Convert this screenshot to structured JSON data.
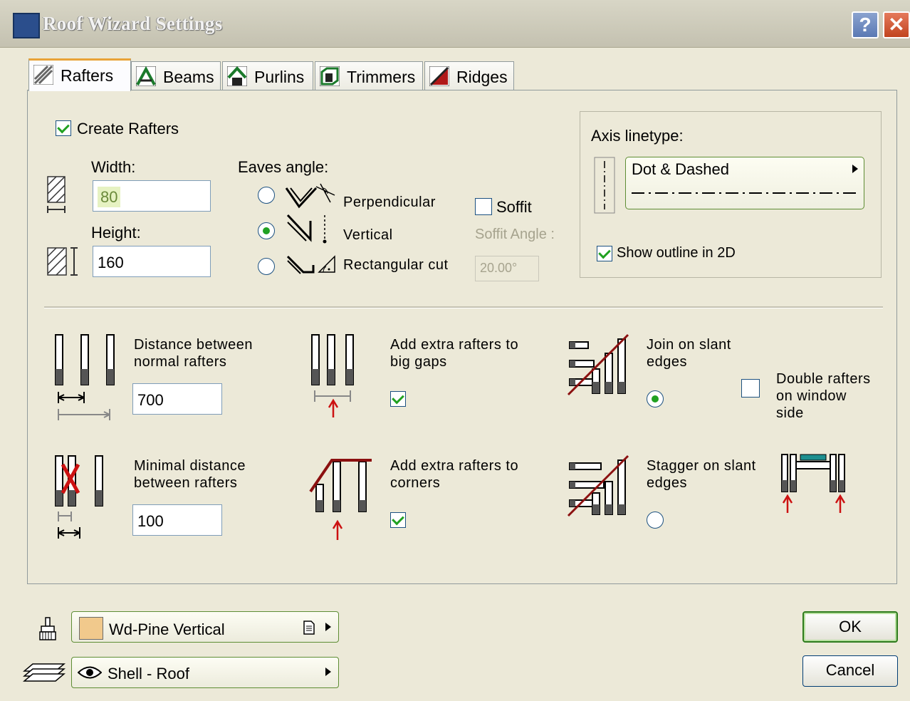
{
  "window": {
    "title": "Roof Wizard Settings",
    "help_label": "?",
    "close_label": "✕"
  },
  "tabs": [
    {
      "label": "Rafters"
    },
    {
      "label": "Beams"
    },
    {
      "label": "Purlins"
    },
    {
      "label": "Trimmers"
    },
    {
      "label": "Ridges"
    }
  ],
  "rafters": {
    "create_label": "Create Rafters",
    "width_label": "Width:",
    "width_value": "80",
    "height_label": "Height:",
    "height_value": "160",
    "eaves": {
      "label": "Eaves angle:",
      "options": [
        {
          "label": "Perpendicular",
          "selected": false
        },
        {
          "label": "Vertical",
          "selected": true
        },
        {
          "label": "Rectangular cut",
          "selected": false
        }
      ]
    },
    "soffit": {
      "label": "Soffit",
      "angle_label": "Soffit Angle :",
      "angle_value": "20.00°"
    }
  },
  "axis": {
    "label": "Axis linetype:",
    "linetype": "Dot & Dashed",
    "show_outline_label": "Show outline in 2D"
  },
  "distance": {
    "normal_label_1": "Distance between",
    "normal_label_2": "normal rafters",
    "normal_value": "700",
    "min_label_1": "Minimal distance",
    "min_label_2": "between rafters",
    "min_value": "100"
  },
  "extras": {
    "big_gaps_1": "Add extra rafters to",
    "big_gaps_2": "big gaps",
    "corners_1": "Add extra rafters to",
    "corners_2": "corners"
  },
  "slant": {
    "join_1": "Join on slant",
    "join_2": "edges",
    "stagger_1": "Stagger on slant",
    "stagger_2": "edges",
    "double_1": "Double rafters",
    "double_2": "on window",
    "double_3": "side"
  },
  "material": {
    "label": "Wd-Pine Vertical"
  },
  "layer": {
    "label": "Shell - Roof"
  },
  "buttons": {
    "ok": "OK",
    "cancel": "Cancel"
  },
  "colors": {
    "accent_check": "#21a121",
    "tab_highlight": "#e9a338",
    "material_swatch": "#f1c98c",
    "red_marker": "#cc1111"
  }
}
